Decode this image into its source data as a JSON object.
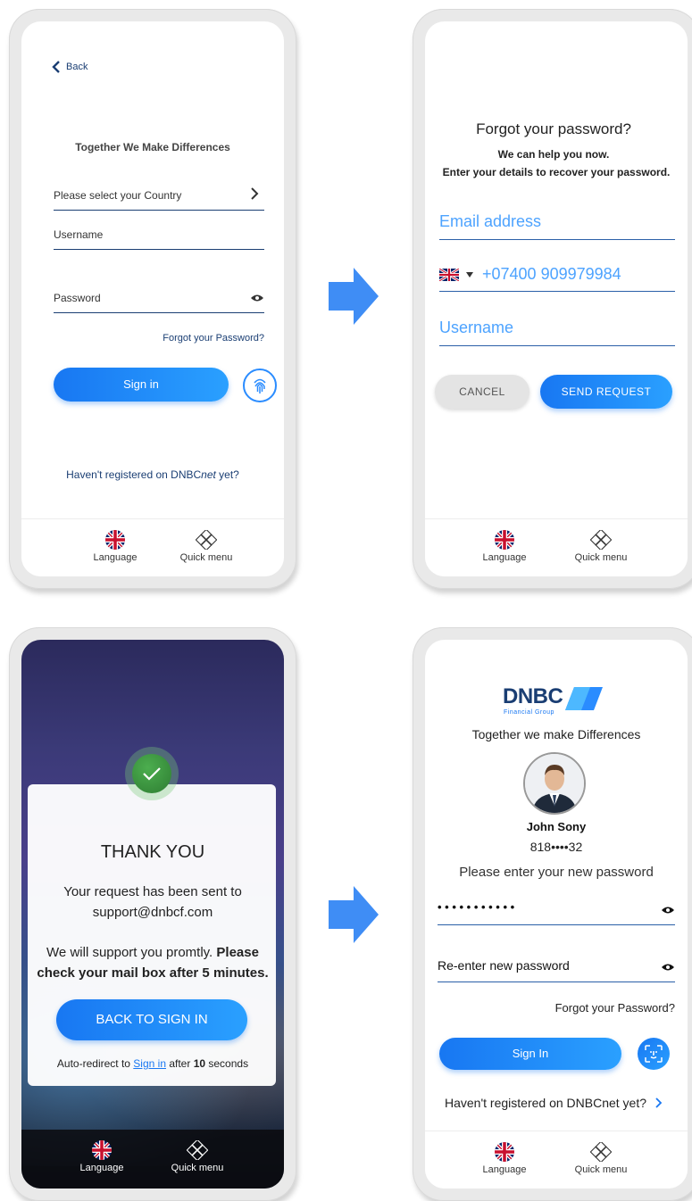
{
  "screen1": {
    "back_label": "Back",
    "tagline": "Together We Make Differences",
    "country_placeholder": "Please select your Country",
    "username_placeholder": "Username",
    "password_placeholder": "Password",
    "forgot_link": "Forgot your Password?",
    "signin_label": "Sign in",
    "register_prefix": "Haven't registered on DNBC",
    "register_em": "net",
    "register_suffix": " yet?",
    "language_label": "Language",
    "quickmenu_label": "Quick menu"
  },
  "screen2": {
    "title": "Forgot your password?",
    "subtitle1": "We can help you now.",
    "subtitle2": "Enter your details to recover your password.",
    "email_placeholder": "Email address",
    "phone_value": "+07400 909979984",
    "username_placeholder": "Username",
    "cancel_label": "CANCEL",
    "send_label": "SEND REQUEST",
    "language_label": "Language",
    "quickmenu_label": "Quick menu"
  },
  "screen3": {
    "title": "THANK YOU",
    "line1": "Your request has been sent to",
    "line2": "support@dnbcf.com",
    "line3": "We will support you promtly.",
    "line3_bold": "Please",
    "line4_bold": "check your mail box after 5 minutes.",
    "back_button": "BACK TO SIGN IN",
    "redirect_prefix": "Auto-redirect to ",
    "redirect_link": "Sign in",
    "redirect_mid": " after ",
    "redirect_seconds": "10",
    "redirect_suffix": " seconds",
    "language_label": "Language",
    "quickmenu_label": "Quick menu"
  },
  "screen4": {
    "logo_text": "DNBC",
    "logo_sub": "Financial Group",
    "tagline": "Together we make Differences",
    "user_name": "John Sony",
    "account_masked": "818••••32",
    "prompt": "Please enter your new password",
    "password_dots": "• • • • • • • • • • •",
    "reenter_placeholder": "Re-enter new password",
    "forgot_link": "Forgot your Password?",
    "signin_label": "Sign In",
    "register_text": "Haven't registered on DNBCnet yet?",
    "language_label": "Language",
    "quickmenu_label": "Quick menu"
  },
  "colors": {
    "accent_blue": "#1877f2",
    "navy": "#1a3e73",
    "light_blue_text": "#4da3ff",
    "success_green": "#2e8b3e"
  }
}
